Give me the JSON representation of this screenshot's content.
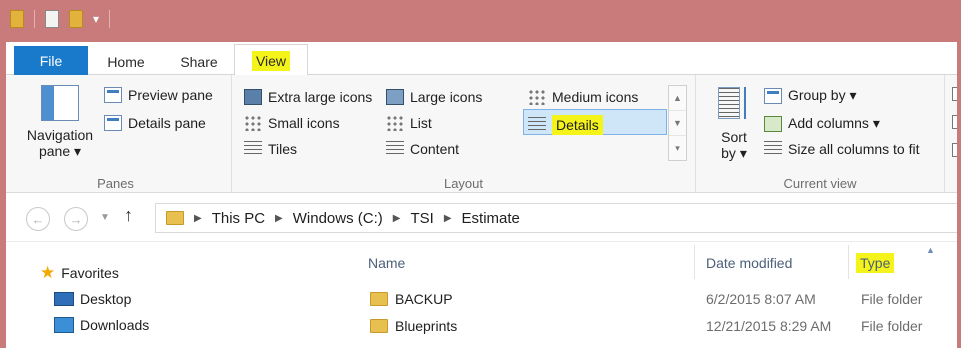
{
  "ribbon_tabs": [
    "File",
    "Home",
    "Share",
    "View"
  ],
  "panes_group": {
    "label": "Panes",
    "navigation_pane_line1": "Navigation",
    "navigation_pane_line2": "pane ▾",
    "preview_pane": "Preview pane",
    "details_pane": "Details pane"
  },
  "layout_group": {
    "label": "Layout",
    "items": [
      "Extra large icons",
      "Large icons",
      "Medium icons",
      "Small icons",
      "List",
      "Details",
      "Tiles",
      "Content"
    ],
    "selected": "Details"
  },
  "current_view_group": {
    "label": "Current view",
    "sort_line1": "Sort",
    "sort_line2": "by ▾",
    "group_by": "Group by ▾",
    "add_columns": "Add columns ▾",
    "size_all_columns": "Size all columns to fit"
  },
  "address_bar": {
    "crumbs": [
      "This PC",
      "Windows (C:)",
      "TSI",
      "Estimate"
    ]
  },
  "nav_pane": {
    "favorites": "Favorites",
    "items": [
      "Desktop",
      "Downloads"
    ]
  },
  "columns": {
    "name": "Name",
    "date_modified": "Date modified",
    "type": "Type"
  },
  "files": [
    {
      "name": "BACKUP",
      "date": "6/2/2015 8:07 AM",
      "type": "File folder"
    },
    {
      "name": "Blueprints",
      "date": "12/21/2015 8:29 AM",
      "type": "File folder"
    }
  ],
  "colors": {
    "title_bar": "#c97b7b",
    "file_tab": "#1979ca",
    "highlight": "#f4f41a",
    "selection": "#cfe5f8"
  }
}
